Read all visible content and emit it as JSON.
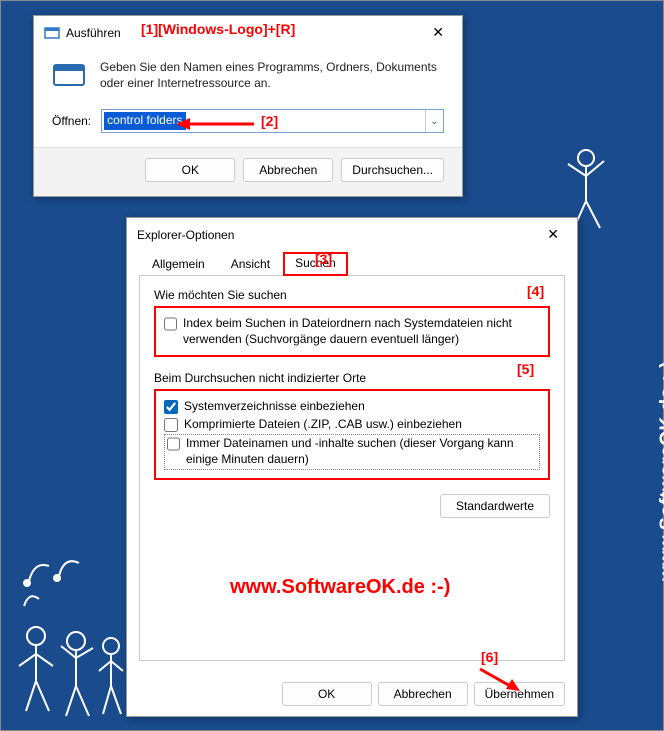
{
  "annotations": {
    "a1": "[1][Windows-Logo]+[R]",
    "a2": "[2]",
    "a3": "[3]",
    "a4": "[4]",
    "a5": "[5]",
    "a6": "[6]"
  },
  "watermark": "www.SoftwareOK.de :-)",
  "run": {
    "title": "Ausführen",
    "desc": "Geben Sie den Namen eines Programms, Ordners, Dokuments oder einer Internetressource an.",
    "open_label": "Öffnen:",
    "open_value": "control folders",
    "ok": "OK",
    "cancel": "Abbrechen",
    "browse": "Durchsuchen..."
  },
  "opt": {
    "title": "Explorer-Optionen",
    "tabs": {
      "general": "Allgemein",
      "view": "Ansicht",
      "search": "Suchen"
    },
    "group1_title": "Wie möchten Sie suchen",
    "chk_index": "Index beim Suchen in Dateiordnern nach Systemdateien nicht verwenden (Suchvorgänge dauern eventuell länger)",
    "group2_title": "Beim Durchsuchen nicht indizierter Orte",
    "chk_sysdirs": "Systemverzeichnisse einbeziehen",
    "chk_compressed": "Komprimierte Dateien (.ZIP, .CAB usw.) einbeziehen",
    "chk_always": "Immer Dateinamen und -inhalte suchen (dieser Vorgang kann einige Minuten dauern)",
    "defaults": "Standardwerte",
    "ok": "OK",
    "cancel": "Abbrechen",
    "apply": "Übernehmen"
  }
}
